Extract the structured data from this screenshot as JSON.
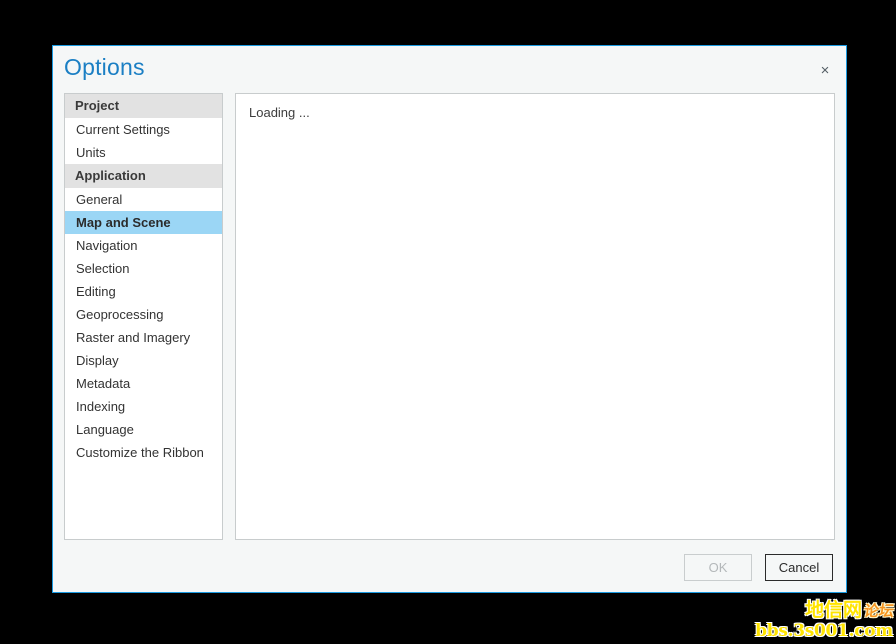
{
  "dialog": {
    "title": "Options",
    "close_icon": "close-icon",
    "close_label": "×"
  },
  "sidebar": {
    "groups": [
      {
        "header": "Project",
        "items": [
          {
            "label": "Current Settings",
            "selected": false
          },
          {
            "label": "Units",
            "selected": false
          }
        ]
      },
      {
        "header": "Application",
        "items": [
          {
            "label": "General",
            "selected": false
          },
          {
            "label": "Map and Scene",
            "selected": true
          },
          {
            "label": "Navigation",
            "selected": false
          },
          {
            "label": "Selection",
            "selected": false
          },
          {
            "label": "Editing",
            "selected": false
          },
          {
            "label": "Geoprocessing",
            "selected": false
          },
          {
            "label": "Raster and Imagery",
            "selected": false
          },
          {
            "label": "Display",
            "selected": false
          },
          {
            "label": "Metadata",
            "selected": false
          },
          {
            "label": "Indexing",
            "selected": false
          },
          {
            "label": "Language",
            "selected": false
          },
          {
            "label": "Customize the Ribbon",
            "selected": false
          }
        ]
      }
    ]
  },
  "content": {
    "loading_text": "Loading ..."
  },
  "footer": {
    "ok_label": "OK",
    "ok_enabled": false,
    "cancel_label": "Cancel",
    "cancel_enabled": true
  },
  "watermark": {
    "line1_main": "地信网",
    "line1_suffix": "论坛",
    "line2": "bbs.3s001.com"
  },
  "colors": {
    "accent_border": "#1a9ae0",
    "title_blue": "#1b7fc4",
    "selection_blue": "#9bd6f5",
    "group_header_gray": "#e2e2e2",
    "dialog_bg": "#f5f7f7",
    "panel_bg": "#ffffff",
    "panel_border": "#c8cccd",
    "backdrop": "#000000",
    "watermark_yellow": "#ffe400",
    "watermark_orange": "#f7941e"
  }
}
